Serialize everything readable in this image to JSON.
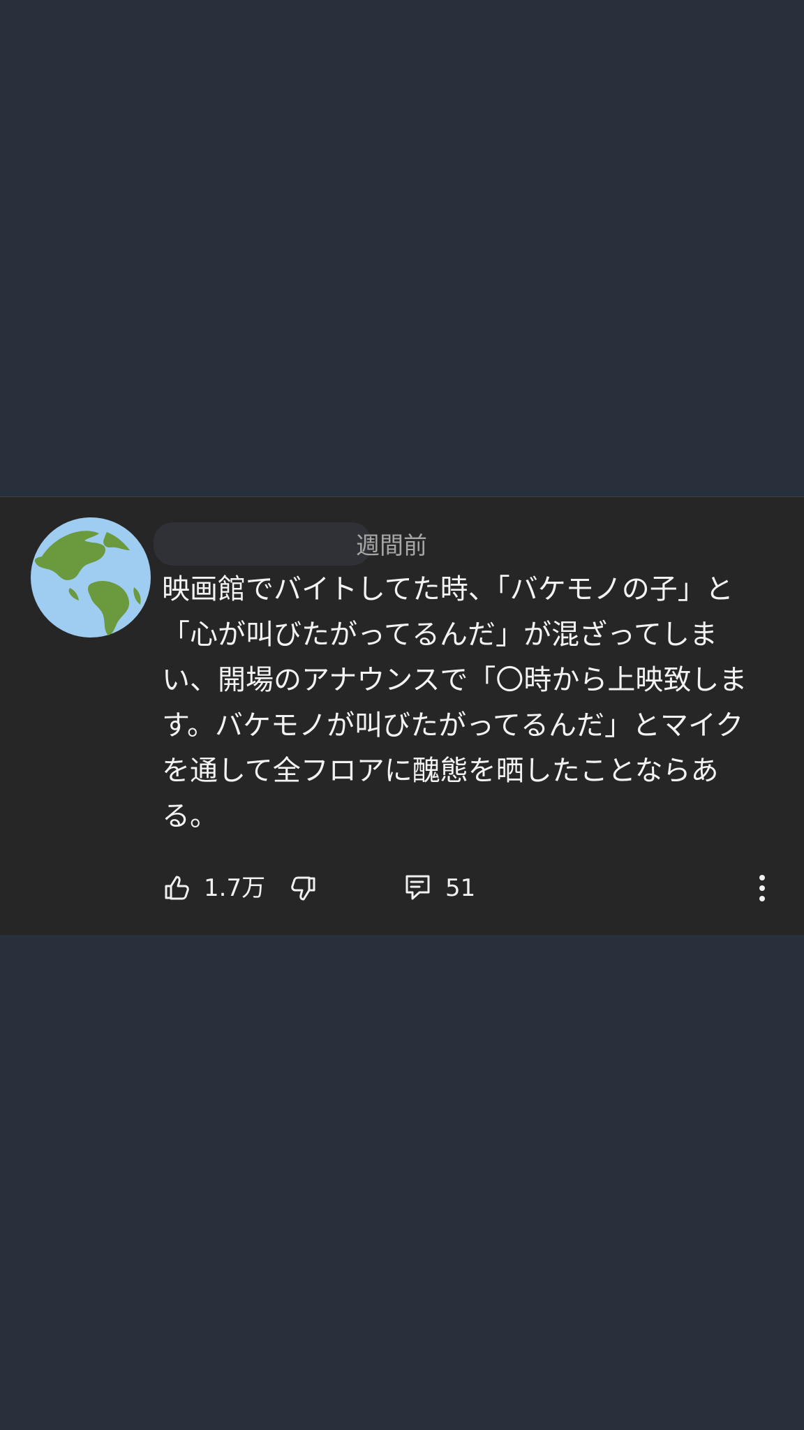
{
  "comment": {
    "timestamp_visible": "週間前",
    "text": "映画館でバイトしてた時、「バケモノの子」と「心が叫びたがってるんだ」が混ざってしまい、開場のアナウンスで「〇時から上映致します。バケモノが叫びたがってるんだ」とマイクを通して全フロアに醜態を晒したことならある。",
    "avatar": "earth-globe-americas-icon",
    "username_redacted": true
  },
  "actions": {
    "like_icon": "thumbs-up-icon",
    "like_count": "1.7万",
    "dislike_icon": "thumbs-down-icon",
    "reply_icon": "reply-comment-icon",
    "reply_count": "51",
    "more_icon": "more-vertical-icon"
  },
  "colors": {
    "page_background": "#27303b",
    "card_background": "#262626",
    "text": "#f3f3f3",
    "secondary_text": "#a7a7a7",
    "globe_ocean": "#9fcdf2",
    "globe_land": "#6a9a3d"
  }
}
